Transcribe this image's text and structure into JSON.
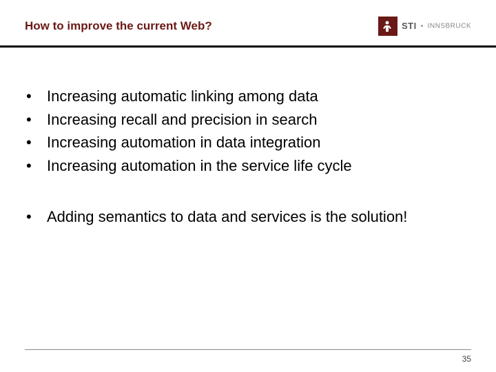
{
  "header": {
    "title": "How to improve the current Web?",
    "logo": {
      "text1": "STI",
      "text2": "INNSBRUCK"
    }
  },
  "content": {
    "group1": [
      "Increasing automatic linking among data",
      "Increasing recall and precision in search",
      "Increasing automation in data integration",
      "Increasing automation in the service life cycle"
    ],
    "group2": [
      "Adding semantics to data and services is the solution!"
    ]
  },
  "footer": {
    "page_number": "35"
  }
}
